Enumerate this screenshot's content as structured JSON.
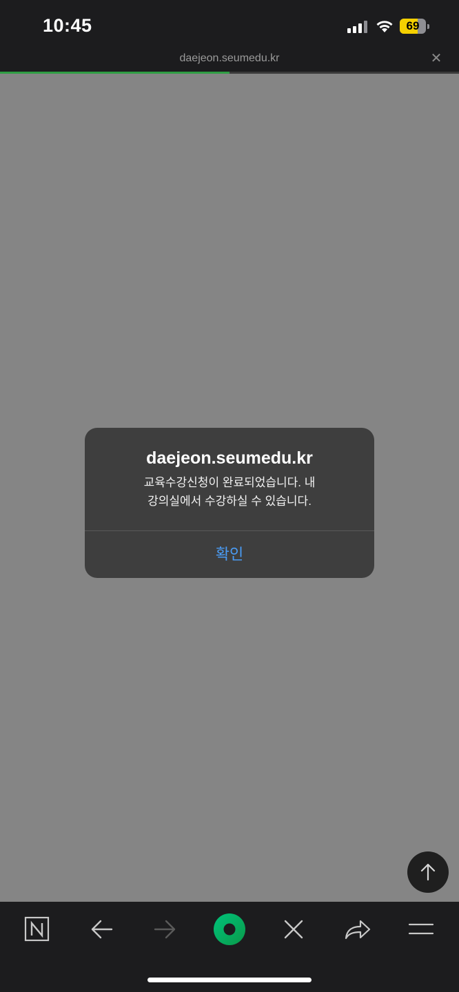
{
  "status_bar": {
    "time": "10:45",
    "battery_percent": 69,
    "battery_label": "69"
  },
  "browser": {
    "url": "daejeon.seumedu.kr",
    "load_progress": 0.5
  },
  "alert": {
    "title": "daejeon.seumedu.kr",
    "message_line1": "교육수강신청이 완료되었습니다. 내",
    "message_line2": "강의실에서 수강하실 수 있습니다.",
    "confirm_label": "확인"
  },
  "colors": {
    "accent_blue": "#4a9cf5",
    "progress_green": "#2f9e44",
    "battery_yellow": "#f5d000"
  },
  "toolbar": {
    "icons": [
      "naver-n-icon",
      "back-arrow-icon",
      "forward-arrow-icon",
      "green-dot-icon",
      "close-icon",
      "share-icon",
      "menu-icon"
    ]
  }
}
